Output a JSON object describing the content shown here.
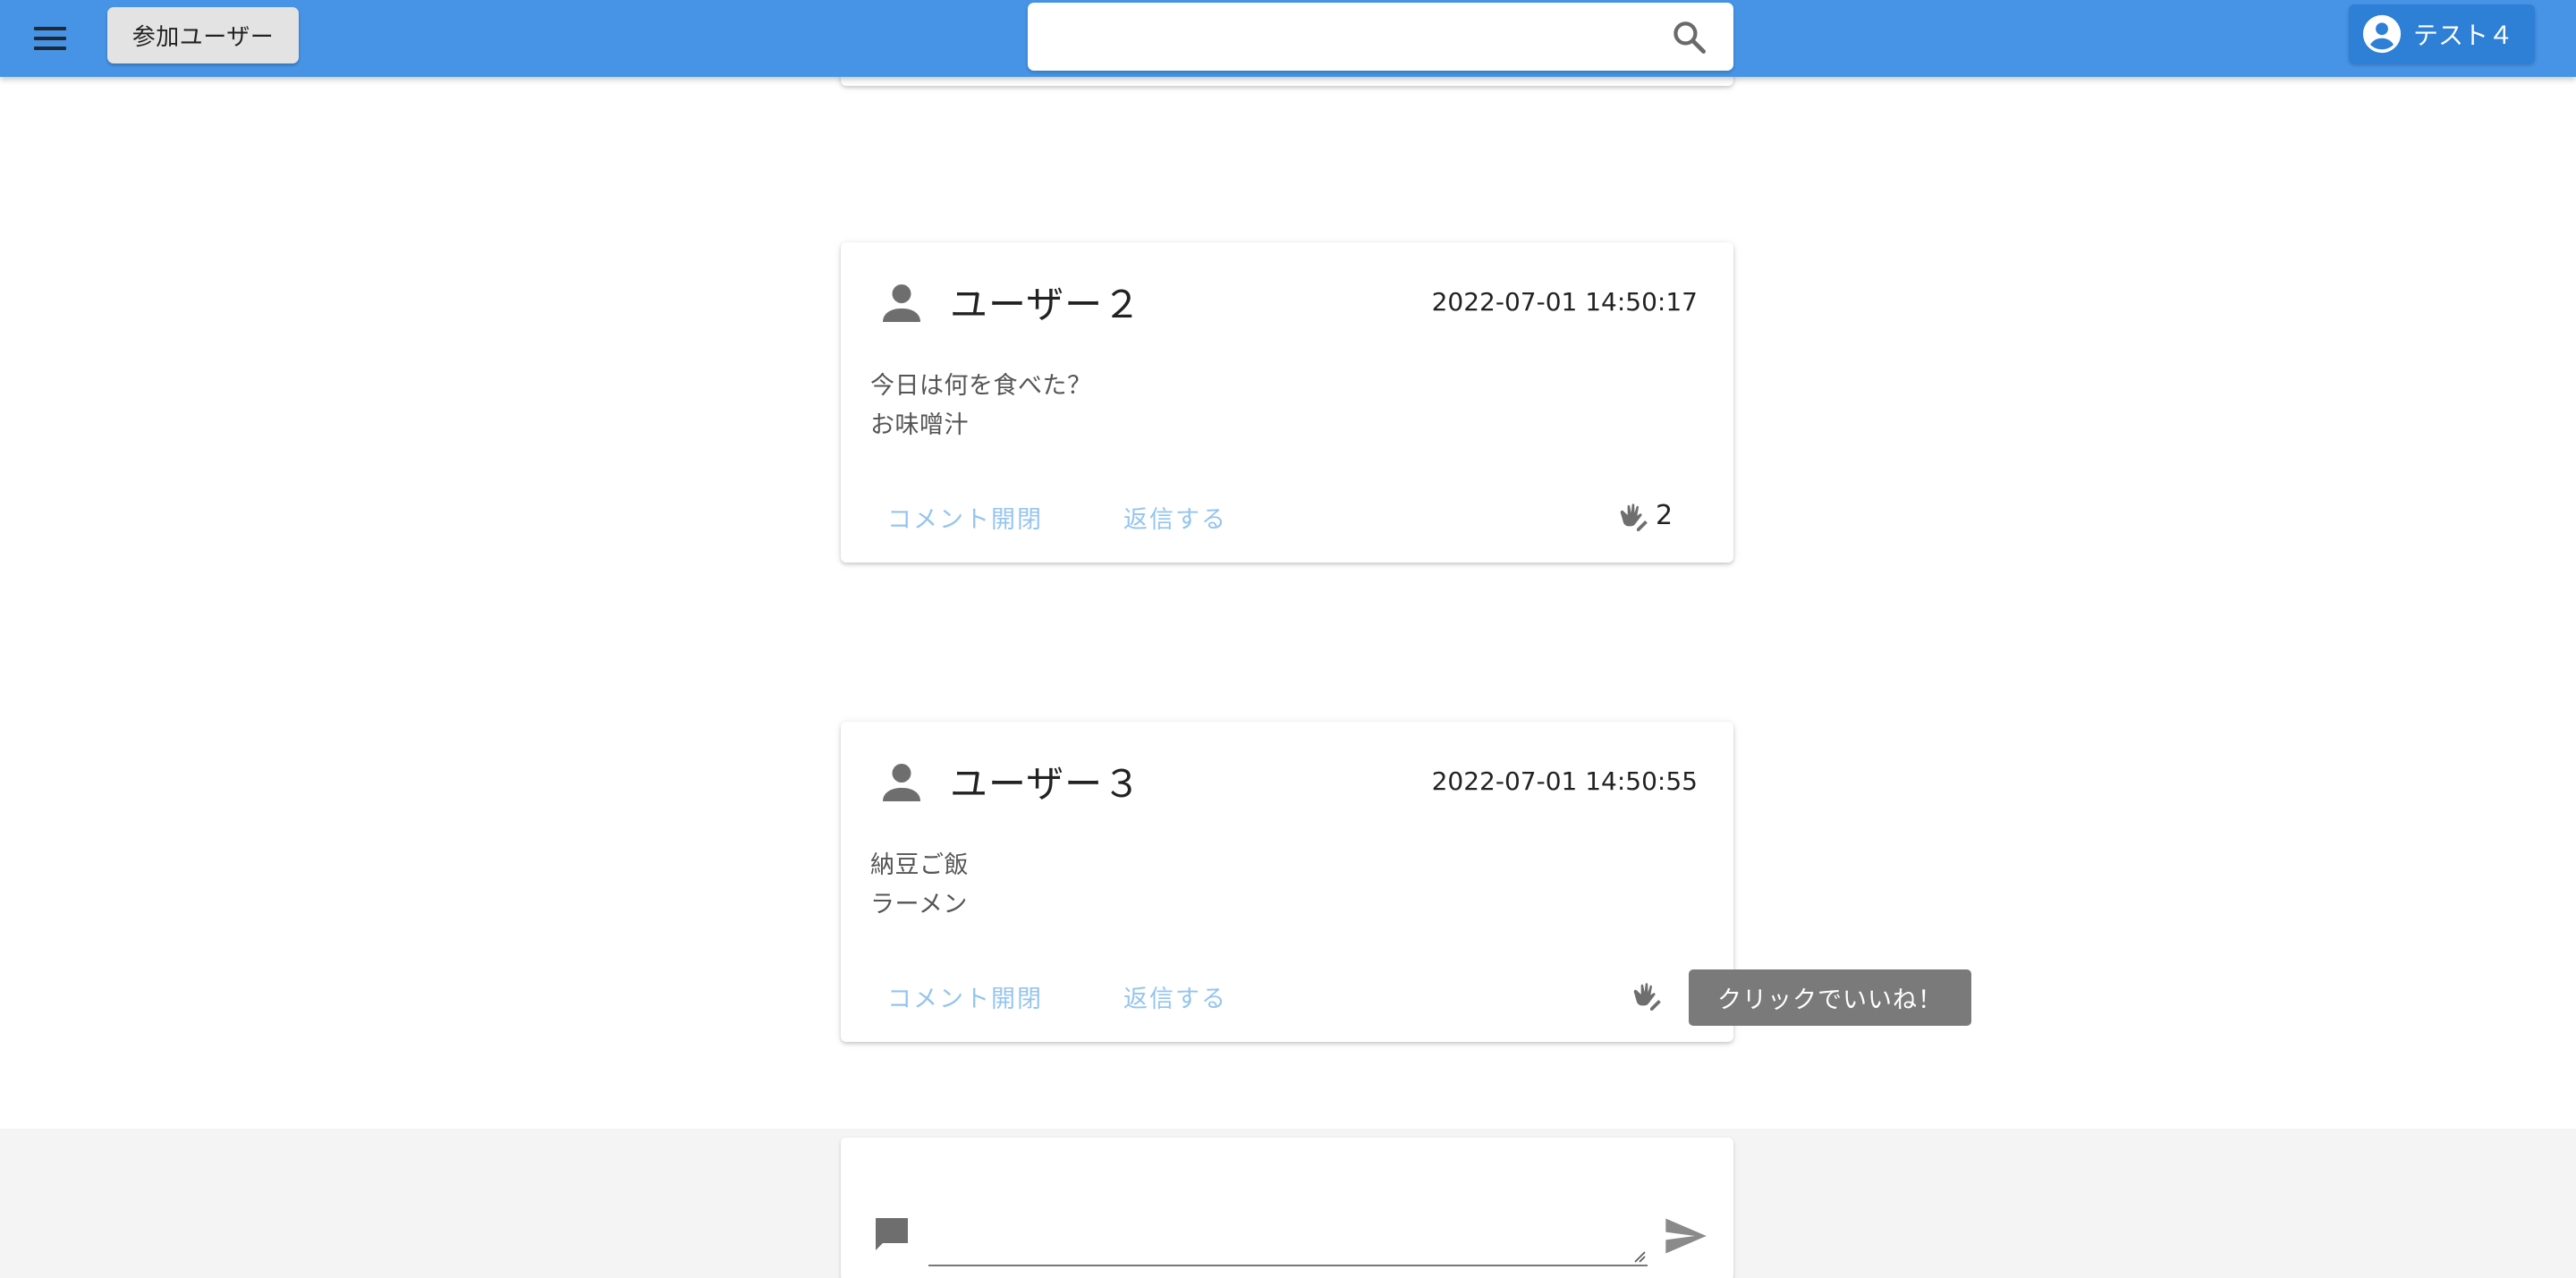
{
  "header": {
    "members_label": "参加ユーザー",
    "search_value": "",
    "account_label": "テスト４"
  },
  "posts": [
    {
      "user": "ユーザー２",
      "timestamp": "2022-07-01 14:50:17",
      "lines": [
        "今日は何を食べた？",
        "お味噌汁"
      ],
      "comment_toggle_label": "コメント開閉",
      "reply_label": "返信する",
      "like_count": "2"
    },
    {
      "user": "ユーザー３",
      "timestamp": "2022-07-01 14:50:55",
      "lines": [
        "納豆ご飯",
        "ラーメン"
      ],
      "comment_toggle_label": "コメント開閉",
      "reply_label": "返信する",
      "like_count": ""
    }
  ],
  "tooltip": "クリックでいいね！",
  "composer": {
    "value": ""
  },
  "colors": {
    "appbar": "#4794e6",
    "account_button": "#2e7fd6",
    "action_link": "#94c4f0",
    "tooltip": "#7a7a7a"
  },
  "icons": [
    "menu-icon",
    "search-icon",
    "account-circle-icon",
    "person-icon",
    "sign-language-icon",
    "comment-icon",
    "send-icon"
  ]
}
